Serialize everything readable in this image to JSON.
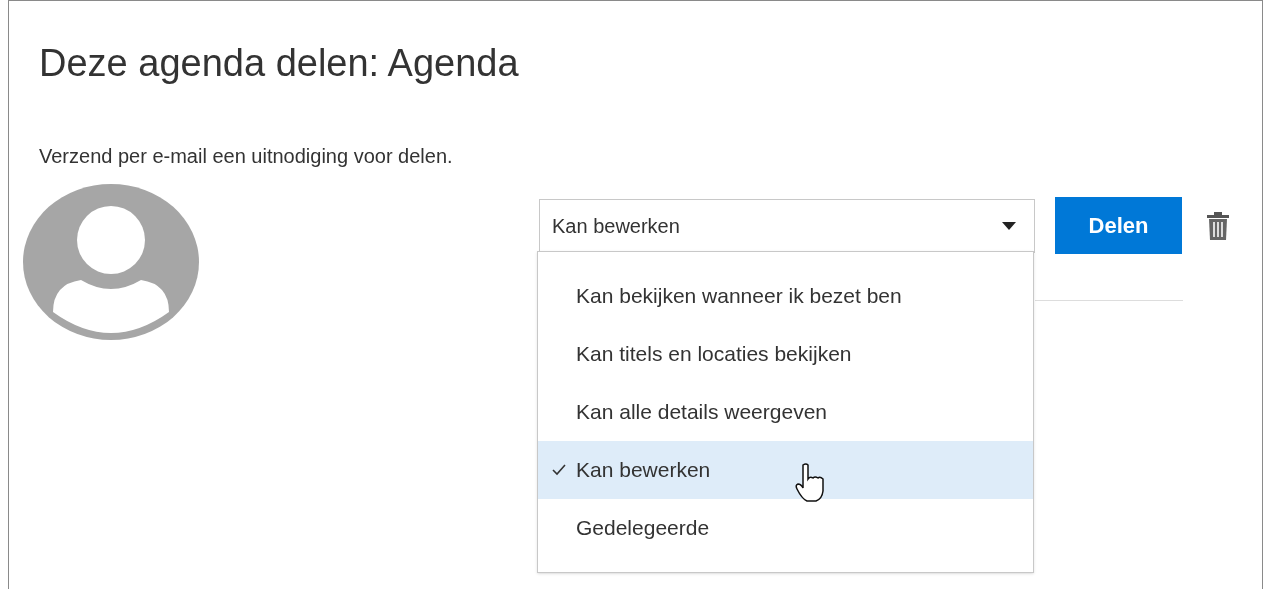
{
  "dialog": {
    "title": "Deze agenda delen: Agenda",
    "subtitle": "Verzend per e-mail een uitnodiging voor delen."
  },
  "permission_select": {
    "value": "Kan bewerken",
    "expanded": true
  },
  "share_button": "Delen",
  "options": [
    {
      "label": "Kan bekijken wanneer ik bezet ben",
      "selected": false
    },
    {
      "label": "Kan titels en locaties bekijken",
      "selected": false
    },
    {
      "label": "Kan alle details weergeven",
      "selected": false
    },
    {
      "label": "Kan bewerken",
      "selected": true
    },
    {
      "label": "Gedelegeerde",
      "selected": false
    }
  ]
}
